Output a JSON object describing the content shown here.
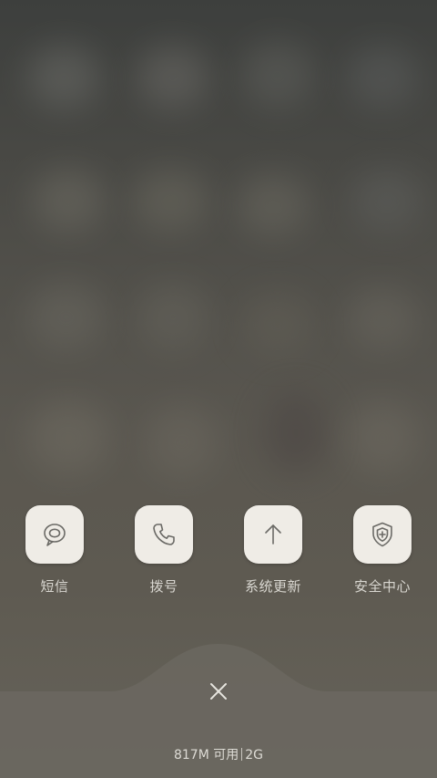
{
  "recent_apps": [
    {
      "label": "短信",
      "icon": "message-bubble-icon"
    },
    {
      "label": "拨号",
      "icon": "phone-icon"
    },
    {
      "label": "系统更新",
      "icon": "arrow-up-icon"
    },
    {
      "label": "安全中心",
      "icon": "shield-plus-icon"
    }
  ],
  "close": {
    "icon": "close-icon"
  },
  "status": {
    "memory": "817M 可用",
    "network": "2G"
  },
  "colors": {
    "icon_tile": "#efece6",
    "icon_stroke": "#6b6a66",
    "label_text": "#d8d6d0",
    "panel": "#66635a"
  }
}
